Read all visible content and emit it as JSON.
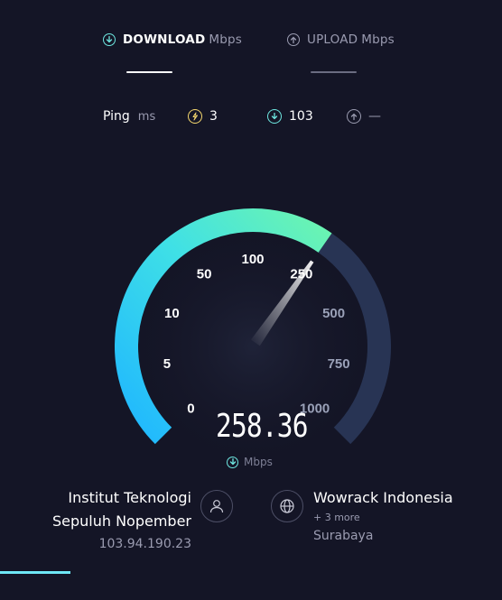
{
  "tabs": {
    "download": {
      "label": "DOWNLOAD",
      "unit": "Mbps"
    },
    "upload": {
      "label": "UPLOAD",
      "unit": "Mbps"
    }
  },
  "ping": {
    "label": "Ping",
    "unit": "ms",
    "idle": "3",
    "download": "103",
    "upload": "—"
  },
  "gauge": {
    "ticks": [
      "0",
      "5",
      "10",
      "50",
      "100",
      "250",
      "500",
      "750",
      "1000"
    ],
    "value": "258.36",
    "unit": "Mbps",
    "colors": {
      "active_start": "#1fb6ff",
      "active_end": "#6cf5b0",
      "inactive": "#283454"
    }
  },
  "client": {
    "isp_line1": "Institut Teknologi",
    "isp_line2": "Sepuluh Nopember",
    "ip": "103.94.190.23"
  },
  "server": {
    "name": "Wowrack Indonesia",
    "more": "+ 3 more",
    "location": "Surabaya"
  },
  "progress": {
    "fraction": 0.14,
    "color": "#6ee7f5"
  }
}
